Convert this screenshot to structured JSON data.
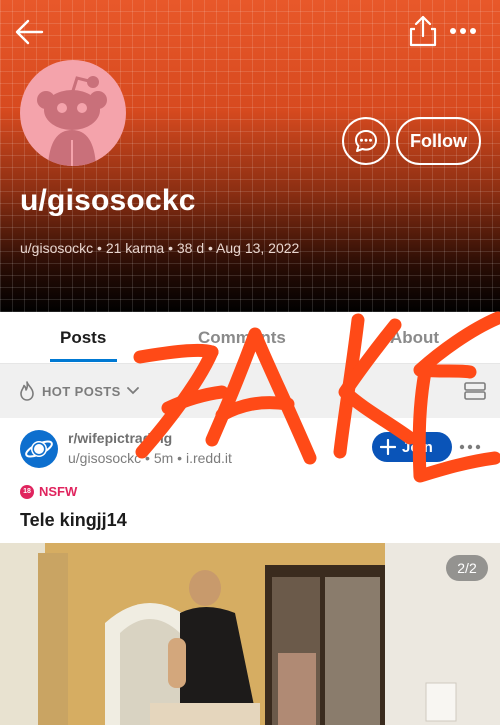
{
  "header": {
    "username": "u/gisosockc",
    "meta": "u/gisosockc • 21 karma • 38 d • Aug 13, 2022",
    "follow_label": "Follow",
    "accent": "#e8582a"
  },
  "tabs": [
    {
      "label": "Posts",
      "active": true
    },
    {
      "label": "Comments",
      "active": false
    },
    {
      "label": "About",
      "active": false
    }
  ],
  "sort": {
    "label": "HOT POSTS"
  },
  "post": {
    "subreddit": "r/wifepictrading",
    "meta": "u/gisosockc • 5m • i.redd.it",
    "join_label": "Join",
    "nsfw_badge": "18",
    "nsfw_label": "NSFW",
    "title": "Tele kingjj14",
    "image_counter": "2/2",
    "brand_color": "#0a54b8"
  },
  "overlay": {
    "text": "FAKE",
    "color": "#ff4a17"
  }
}
